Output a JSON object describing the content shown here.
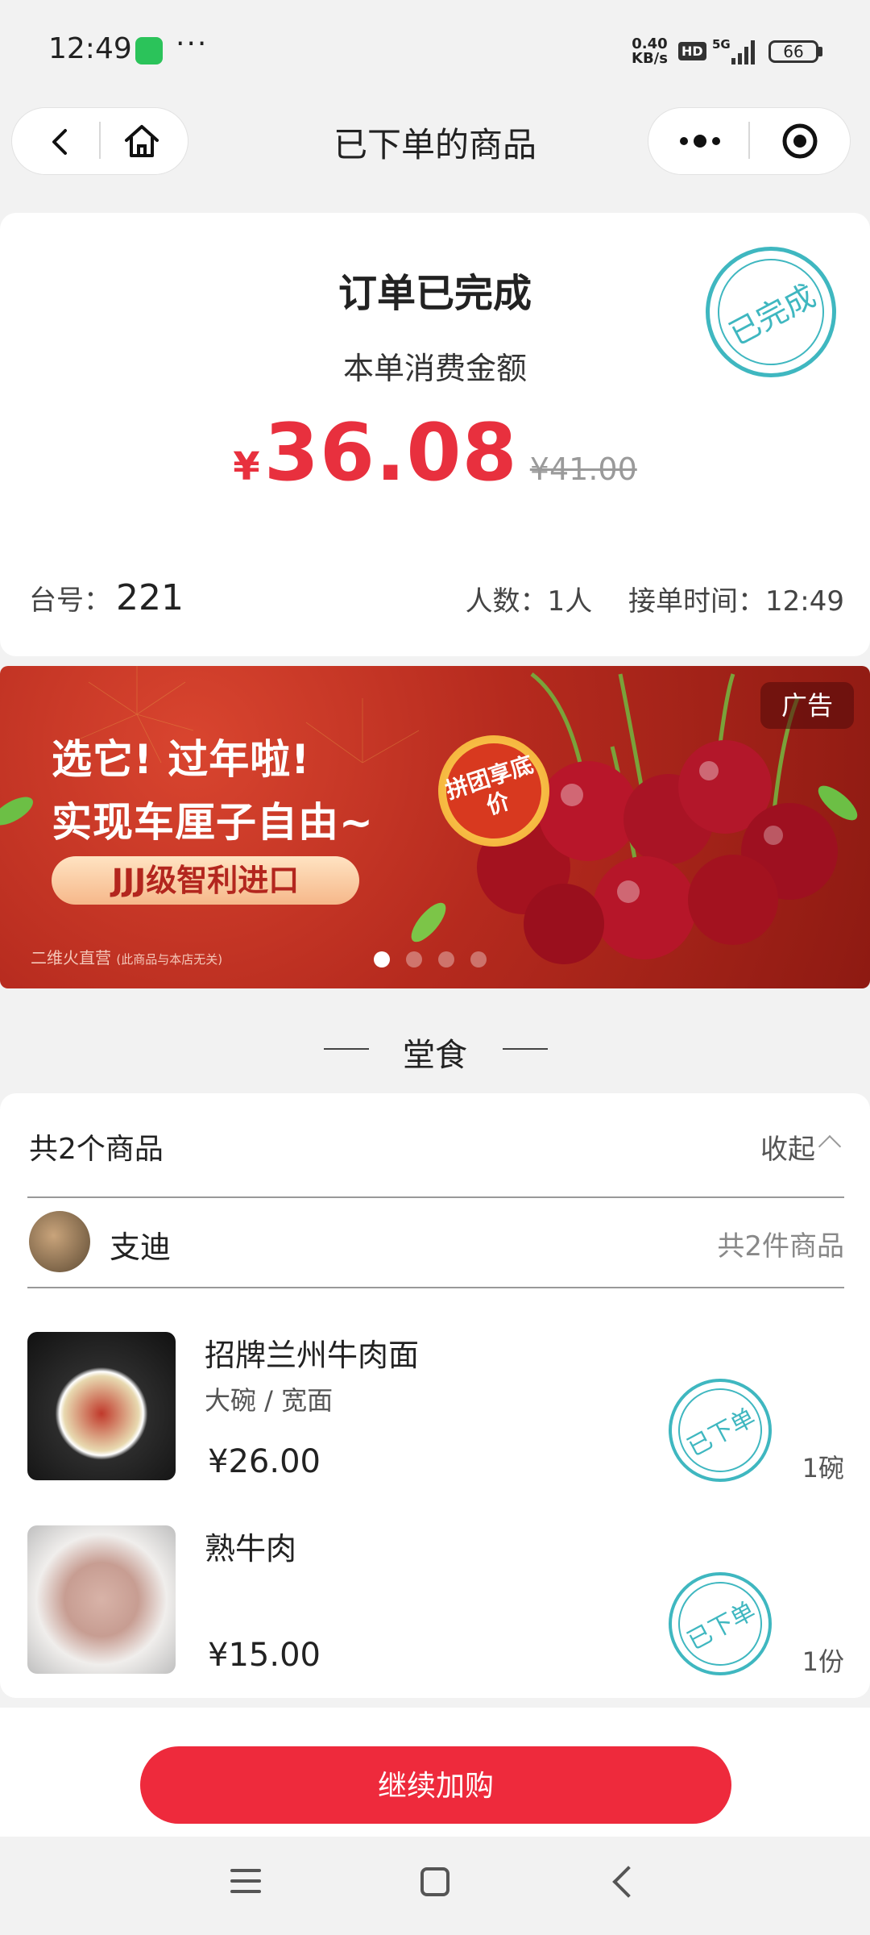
{
  "status_bar": {
    "time": "12:49",
    "dots": "···",
    "net_speed_value": "0.40",
    "net_speed_unit": "KB/s",
    "hd": "HD",
    "network": "5G",
    "battery": "66"
  },
  "nav": {
    "title": "已下单的商品"
  },
  "order": {
    "status": "订单已完成",
    "amount_label": "本单消费金额",
    "currency": "¥",
    "amount": "36.08",
    "original_amount": "¥41.00",
    "stamp": "已完成",
    "table_label": "台号：",
    "table_number": "221",
    "people_info": "人数：1人",
    "time_info": "接单时间：12:49"
  },
  "banner": {
    "ad_label": "广告",
    "line1": "选它! 过年啦!",
    "line2": "实现车厘子自由~",
    "pill_text": "JJJ级智利进口",
    "tag_text": "拼团享底价",
    "source": "二维火直营",
    "source_note": "(此商品与本店无关)",
    "page_count": 4,
    "active_index": 0
  },
  "section": {
    "title": "堂食"
  },
  "items": {
    "count_label": "共2个商品",
    "collapse_label": "收起",
    "shop_name": "支迪",
    "shop_count": "共2件商品",
    "list": [
      {
        "name": "招牌兰州牛肉面",
        "spec": "大碗 / 宽面",
        "price": "¥26.00",
        "qty": "1碗",
        "stamp": "已下单"
      },
      {
        "name": "熟牛肉",
        "spec": "",
        "price": "¥15.00",
        "qty": "1份",
        "stamp": "已下单"
      }
    ]
  },
  "actions": {
    "continue_label": "继续加购"
  },
  "colors": {
    "primary_red": "#ee2a3c",
    "price_red": "#e8303e",
    "stamp_teal": "#3fb7c0"
  }
}
